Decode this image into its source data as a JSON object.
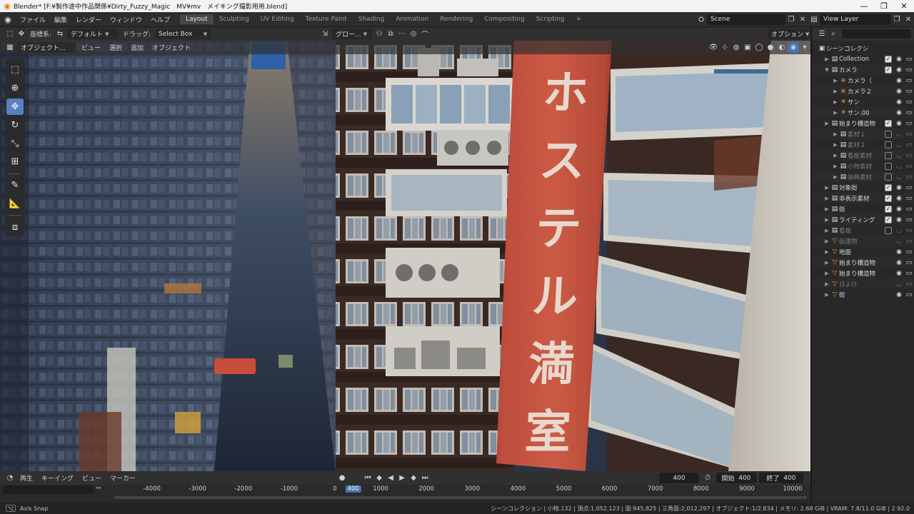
{
  "window": {
    "title": "Blender* [F:¥製作途中作品関係¥Dirty_Fuzzy_Magic　MV¥mv　メイキング撮影用用.blend]",
    "minimize": "—",
    "maximize": "❐",
    "close": "✕"
  },
  "menu": [
    "ファイル",
    "編集",
    "レンダー",
    "ウィンドウ",
    "ヘルプ"
  ],
  "workspaces": [
    "Layout",
    "Sculpting",
    "UV Editing",
    "Texture Paint",
    "Shading",
    "Animation",
    "Rendering",
    "Compositing",
    "Scripting"
  ],
  "active_workspace": "Layout",
  "add_workspace": "+",
  "scene": {
    "label": "Scene",
    "view_layer": "View Layer"
  },
  "tool_header": {
    "orientation_label": "座標系:",
    "orientation_value": "デフォルト",
    "drag_label": "ドラッグ:",
    "drag_value": "Select Box",
    "transform_value": "グロー...",
    "options": "オプション"
  },
  "viewport_header": {
    "mode": "オブジェクト...",
    "menus": [
      "ビュー",
      "選択",
      "追加",
      "オブジェクト"
    ]
  },
  "sign": {
    "glyphs": [
      "ホ",
      "ス",
      "テ",
      "ル",
      "満",
      "室"
    ]
  },
  "outliner": {
    "title": "シーンコレクシ",
    "rows": [
      {
        "label": "Collection",
        "icon": "collection-icon",
        "depth": 1,
        "checked": true,
        "dim": false
      },
      {
        "label": "カメラ",
        "icon": "collection-icon",
        "depth": 1,
        "checked": true,
        "dim": false,
        "expanded": true
      },
      {
        "label": "カメラ（",
        "icon": "camera-icon",
        "depth": 2,
        "checked": null,
        "dim": false
      },
      {
        "label": "カメラ２",
        "icon": "camera-icon",
        "depth": 2,
        "checked": null,
        "dim": false
      },
      {
        "label": "サン",
        "icon": "light-icon",
        "depth": 2,
        "checked": null,
        "dim": false
      },
      {
        "label": "サン.00",
        "icon": "light-icon",
        "depth": 2,
        "checked": null,
        "dim": false
      },
      {
        "label": "始まり構造物",
        "icon": "collection-icon",
        "depth": 1,
        "checked": true,
        "dim": false
      },
      {
        "label": "素材１",
        "icon": "collection-icon",
        "depth": 2,
        "checked": false,
        "dim": true
      },
      {
        "label": "素材２",
        "icon": "collection-icon",
        "depth": 2,
        "checked": false,
        "dim": true
      },
      {
        "label": "看板素材",
        "icon": "collection-icon",
        "depth": 2,
        "checked": false,
        "dim": true
      },
      {
        "label": "小物素材",
        "icon": "collection-icon",
        "depth": 2,
        "checked": false,
        "dim": true
      },
      {
        "label": "装飾素材",
        "icon": "collection-icon",
        "depth": 2,
        "checked": false,
        "dim": true
      },
      {
        "label": "対象街",
        "icon": "collection-icon",
        "depth": 1,
        "checked": true,
        "dim": false
      },
      {
        "label": "非表示素材",
        "icon": "collection-icon",
        "depth": 1,
        "checked": true,
        "dim": false
      },
      {
        "label": "街",
        "icon": "collection-icon",
        "depth": 1,
        "checked": true,
        "dim": false
      },
      {
        "label": "ライティング",
        "icon": "collection-icon",
        "depth": 1,
        "checked": true,
        "dim": false
      },
      {
        "label": "看板",
        "icon": "collection-icon",
        "depth": 1,
        "checked": false,
        "dim": true
      },
      {
        "label": "仮建物",
        "icon": "mesh-icon",
        "depth": 1,
        "checked": null,
        "dim": true
      },
      {
        "label": "地面",
        "icon": "mesh-icon",
        "depth": 1,
        "checked": null,
        "dim": false
      },
      {
        "label": "始まり構造物",
        "icon": "mesh-icon",
        "depth": 1,
        "checked": null,
        "dim": false
      },
      {
        "label": "始まり構造物",
        "icon": "mesh-icon",
        "depth": 1,
        "checked": null,
        "dim": false
      },
      {
        "label": "日よけ",
        "icon": "mesh-icon",
        "depth": 1,
        "checked": null,
        "dim": true
      },
      {
        "label": "街",
        "icon": "mesh-icon",
        "depth": 1,
        "checked": null,
        "dim": false
      }
    ]
  },
  "timeline": {
    "menus": [
      "再生",
      "キーイング",
      "ビュー",
      "マーカー"
    ],
    "current_frame": "400",
    "start_label": "開始",
    "start": "400",
    "end_label": "終了",
    "end": "400",
    "ruler": [
      "-4000",
      "-3000",
      "-2000",
      "-1000",
      "0",
      "400",
      "1000",
      "2000",
      "3000",
      "4000",
      "5000",
      "6000",
      "7000",
      "8000",
      "9000",
      "10000"
    ]
  },
  "status": {
    "left": "Axis Snap",
    "right": "シーンコレクション | 小物.132 | 頂点:1,052,123 | 面:945,825 | 三角面:2,012,297 | オブジェクト:1/2,834 | メモリ: 2.68 GiB | VRAM: 7.8/11.0 GiB | 2.92.0"
  },
  "colors": {
    "accent": "#4772b3",
    "sign": "#c9553f",
    "sky": "#2f5fa8"
  }
}
